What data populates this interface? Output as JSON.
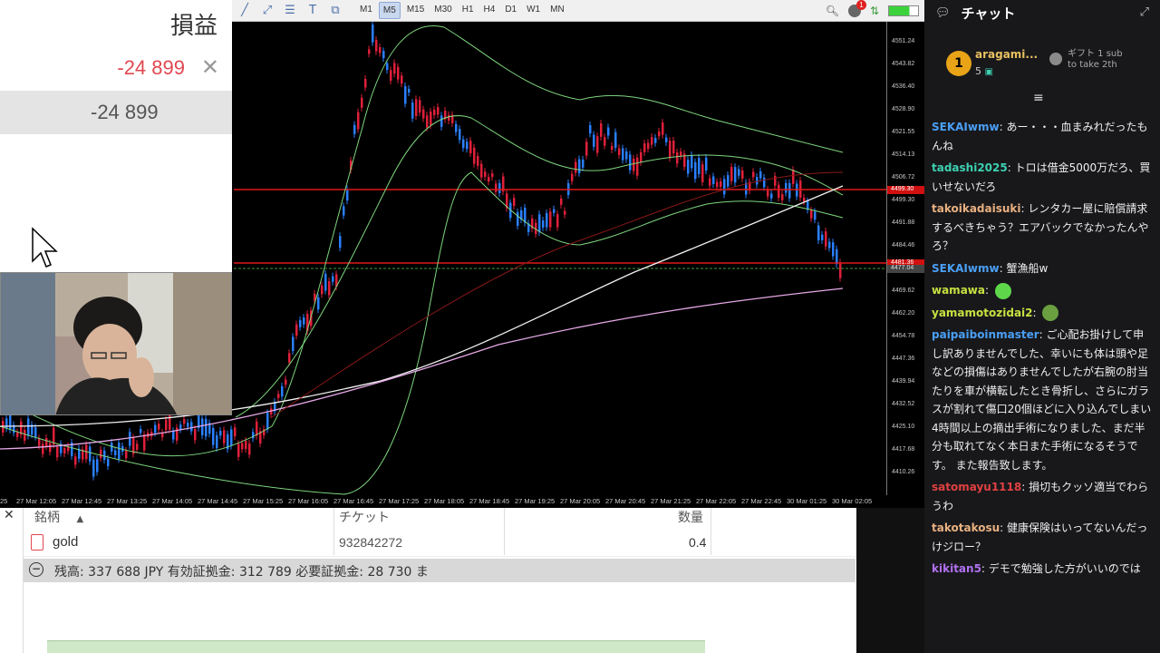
{
  "toolbar": {
    "timeframes": [
      "M1",
      "M5",
      "M15",
      "M30",
      "H1",
      "H4",
      "D1",
      "W1",
      "MN"
    ],
    "active_timeframe": "M5",
    "notification_count": "1"
  },
  "price_axis": {
    "labels": [
      "4551.24",
      "4543.82",
      "4536.40",
      "4528.90",
      "4521.55",
      "4514.13",
      "4506.72",
      "4499.30",
      "4491.88",
      "4484.46",
      "4477.04",
      "4469.62",
      "4462.20",
      "4454.78",
      "4447.36",
      "4439.94",
      "4432.52",
      "4425.10",
      "4417.68",
      "4410.26"
    ],
    "tag_upper": "4499.30",
    "tag_lower": "4481.36",
    "tag_grey": "4477.04"
  },
  "time_axis": {
    "labels": [
      "25",
      "27 Mar 12:05",
      "27 Mar 12:45",
      "27 Mar 13:25",
      "27 Mar 14:05",
      "27 Mar 14:45",
      "27 Mar 15:25",
      "27 Mar 16:05",
      "27 Mar 16:45",
      "27 Mar 17:25",
      "27 Mar 18:05",
      "27 Mar 18:45",
      "27 Mar 19:25",
      "27 Mar 20:05",
      "27 Mar 20:45",
      "27 Mar 21:25",
      "27 Mar 22:05",
      "27 Mar 22:45",
      "30 Mar 01:25",
      "30 Mar 02:05"
    ]
  },
  "pnl": {
    "header": "損益",
    "position_pnl": "-24 899",
    "total_pnl": "-24 899"
  },
  "positions": {
    "col_symbol": "銘柄",
    "col_ticket": "チケット",
    "col_volume": "数量",
    "row": {
      "symbol": "gold",
      "ticket": "932842272",
      "volume": "0.4"
    },
    "balance": "残高: 337 688 JPY  有効証拠金: 312 789  必要証拠金: 28 730  ま"
  },
  "chat": {
    "title": "チャット",
    "leader": {
      "rank": "1",
      "name": "aragami...",
      "count": "5"
    },
    "gift_line1": "ギフト 1 sub",
    "gift_line2": "to take 2th",
    "messages": [
      {
        "user": "SEKAIwmw",
        "color": "#4a9ff5",
        "text": "あー・・・血まみれだったもんね"
      },
      {
        "user": "tadashi2025",
        "color": "#3dd0b0",
        "text": "トロは借金5000万だろ、買いせないだろ"
      },
      {
        "user": "takoikadaisuki",
        "color": "#e8b080",
        "text": "レンタカー屋に賠償請求するべきちゃう？エアバックでなかったんやろ？"
      },
      {
        "user": "SEKAIwmw",
        "color": "#4a9ff5",
        "text": "蟹漁船w"
      },
      {
        "user": "wamawa",
        "color": "#c8e040",
        "text": ""
      },
      {
        "user": "yamamotozidai2",
        "color": "#c8e040",
        "text": ""
      },
      {
        "user": "paipaiboinmaster",
        "color": "#4a9ff5",
        "text": "ご心配お掛けして申し訳ありませんでした、幸いにも体は頭や足などの損傷はありませんでしたが右腕の肘当たりを車が横転したとき骨折し、さらにガラスが割れて傷口20個ほどに入り込んでしまい4時間以上の摘出手術になりました、まだ半分も取れてなく本日また手術になるそうです。 また報告致します。"
      },
      {
        "user": "satomayu1118",
        "color": "#e04040",
        "text": "損切もクッソ適当でわらうわ"
      },
      {
        "user": "takotakosu",
        "color": "#e8b080",
        "text": "健康保険はいってないんだっけジロー？"
      },
      {
        "user": "kikitan5",
        "color": "#b070f0",
        "text": "デモで勉強した方がいいのでは"
      }
    ]
  }
}
